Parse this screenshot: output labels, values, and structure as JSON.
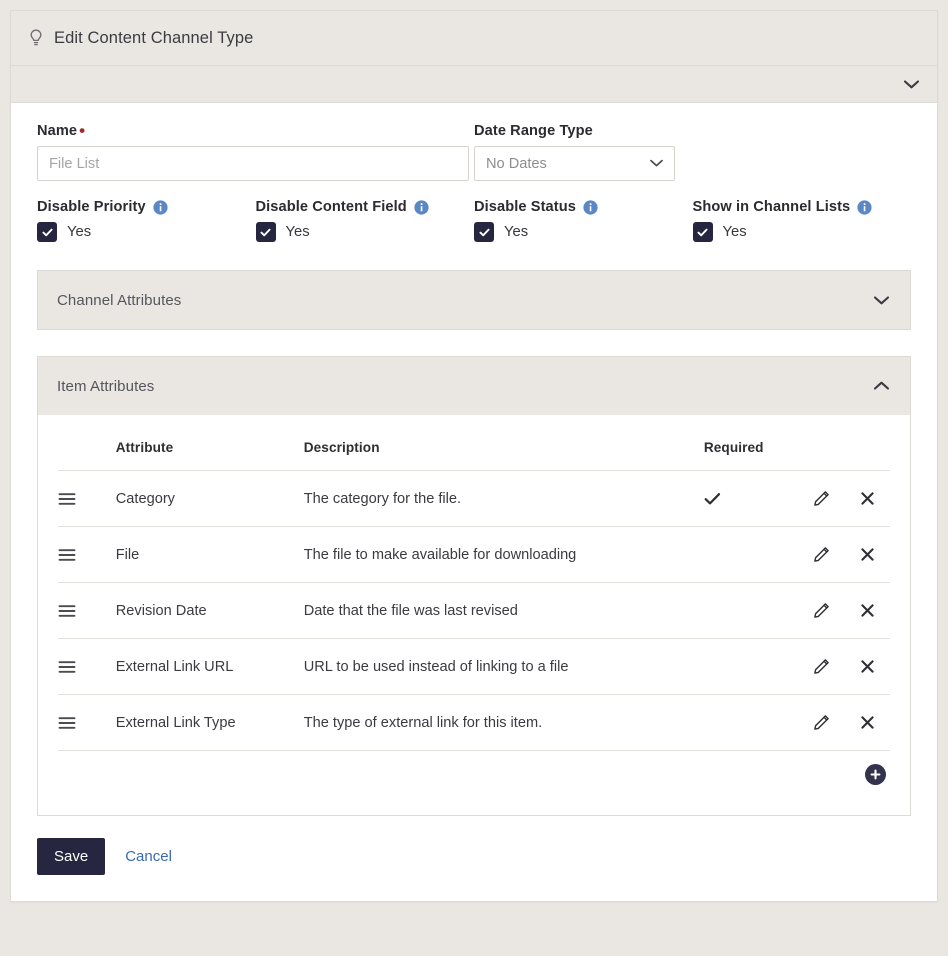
{
  "header": {
    "title": "Edit Content Channel Type",
    "icon": "lightbulb-icon",
    "collapse_icon": "chevron-down-icon"
  },
  "form": {
    "name": {
      "label": "Name",
      "required_marker": "•",
      "value": "",
      "placeholder": "File List"
    },
    "date_range_type": {
      "label": "Date Range Type",
      "selected": "No Dates",
      "options": [
        "No Dates"
      ]
    },
    "checkboxes": [
      {
        "label": "Disable Priority",
        "info_icon": "info-icon",
        "value_label": "Yes",
        "checked": true
      },
      {
        "label": "Disable Content Field",
        "info_icon": "info-icon",
        "value_label": "Yes",
        "checked": true
      },
      {
        "label": "Disable Status",
        "info_icon": "info-icon",
        "value_label": "Yes",
        "checked": true
      },
      {
        "label": "Show in Channel Lists",
        "info_icon": "info-icon",
        "value_label": "Yes",
        "checked": true
      }
    ]
  },
  "accordions": [
    {
      "title": "Channel Attributes",
      "expanded": false,
      "icon": "chevron-down-icon"
    },
    {
      "title": "Item Attributes",
      "expanded": true,
      "icon": "chevron-up-icon"
    }
  ],
  "item_attributes_table": {
    "columns": [
      "",
      "Attribute",
      "Description",
      "Required",
      "",
      ""
    ],
    "headers": {
      "attribute": "Attribute",
      "description": "Description",
      "required": "Required"
    },
    "rows": [
      {
        "handle_icon": "drag-handle-icon",
        "attribute": "Category",
        "description": "The category for the file.",
        "required": true,
        "edit_icon": "pencil-icon",
        "delete_icon": "close-icon"
      },
      {
        "handle_icon": "drag-handle-icon",
        "attribute": "File",
        "description": "The file to make available for downloading",
        "required": false,
        "edit_icon": "pencil-icon",
        "delete_icon": "close-icon"
      },
      {
        "handle_icon": "drag-handle-icon",
        "attribute": "Revision Date",
        "description": "Date that the file was last revised",
        "required": false,
        "edit_icon": "pencil-icon",
        "delete_icon": "close-icon"
      },
      {
        "handle_icon": "drag-handle-icon",
        "attribute": "External Link URL",
        "description": "URL to be used instead of linking to a file",
        "required": false,
        "edit_icon": "pencil-icon",
        "delete_icon": "close-icon"
      },
      {
        "handle_icon": "drag-handle-icon",
        "attribute": "External Link Type",
        "description": "The type of external link for this item.",
        "required": false,
        "edit_icon": "pencil-icon",
        "delete_icon": "close-icon"
      }
    ],
    "add_button_icon": "plus-circle-icon"
  },
  "footer": {
    "save_label": "Save",
    "cancel_label": "Cancel"
  },
  "colors": {
    "accent_dark": "#262640",
    "link_blue": "#3c6ab0",
    "info_blue": "#5b87c5",
    "required_red": "#9b2d2d",
    "panel_header_bg": "#eae7e3",
    "page_bg": "#eae7e3"
  }
}
